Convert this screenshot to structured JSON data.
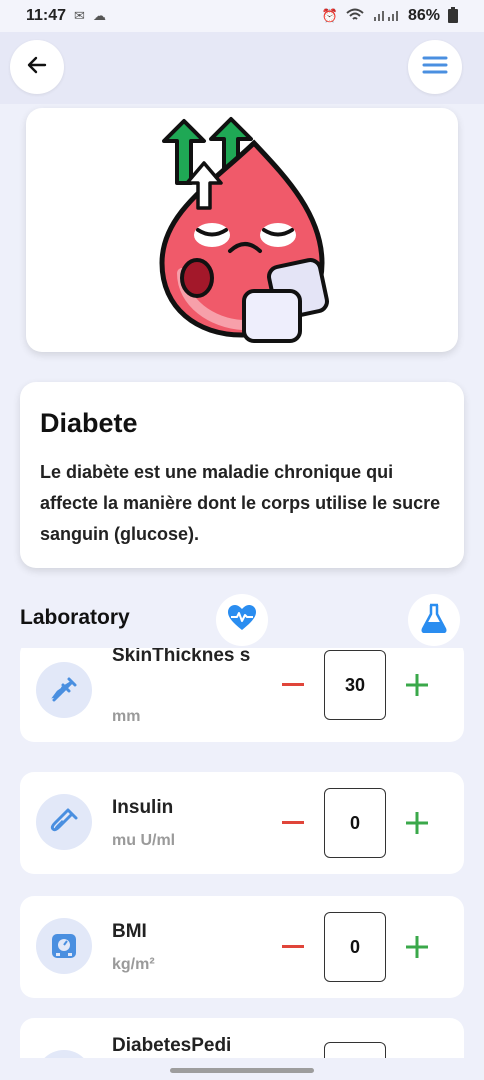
{
  "status_bar": {
    "time": "11:47",
    "battery": "86%"
  },
  "header": {
    "back_icon": "arrow-left-icon",
    "menu_icon": "hamburger-menu-icon"
  },
  "disease": {
    "title": "Diabete",
    "description": "Le diabète est une maladie chronique qui affecte la manière dont le corps utilise le sucre sanguin (glucose)."
  },
  "section": {
    "title": "Laboratory",
    "tabs": [
      {
        "icon": "heart-pulse-icon",
        "color": "#2a8df0"
      },
      {
        "icon": "flask-icon",
        "color": "#2a8df0"
      }
    ]
  },
  "colors": {
    "minus": "#e0453a",
    "plus": "#3aa84a",
    "icon": "#4a8fe0",
    "blood": "#f05a6a",
    "arrow": "#1fa855"
  },
  "lab_items": [
    {
      "name": "SkinThicknes s",
      "unit": "mm",
      "value": "30",
      "icon": "syringe-icon"
    },
    {
      "name": "Insulin",
      "unit": "mu U/ml",
      "value": "0",
      "icon": "test-tube-icon"
    },
    {
      "name": "BMI",
      "unit": "kg/m²",
      "value": "0",
      "icon": "scale-icon"
    },
    {
      "name": "DiabetesPedi",
      "unit": "",
      "value": "",
      "icon": "dna-icon"
    }
  ]
}
